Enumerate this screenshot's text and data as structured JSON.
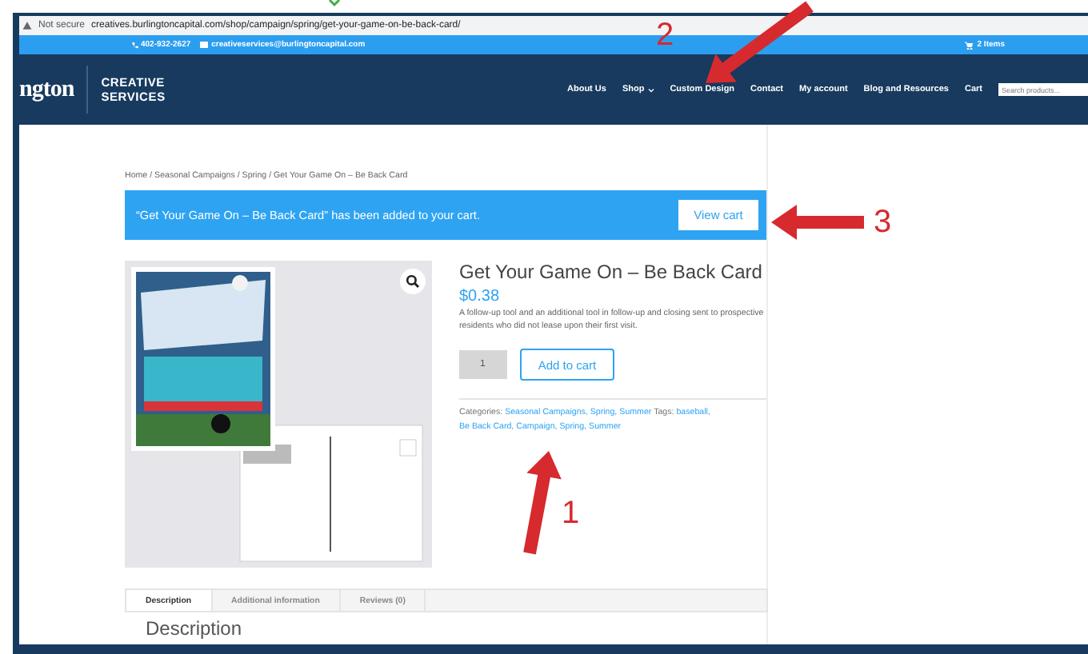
{
  "browser": {
    "security": "Not secure",
    "url": "creatives.burlingtoncapital.com/shop/campaign/spring/get-your-game-on-be-back-card/"
  },
  "top_bar": {
    "phone": "402-932-2627",
    "email": "creativeservices@burlingtoncapital.com",
    "cart": "2 Items"
  },
  "header": {
    "logo_text": "ngton",
    "brand_lines": [
      "CREATIVE",
      "SERVICES"
    ],
    "nav": [
      {
        "label": "About Us",
        "dropdown": false
      },
      {
        "label": "Shop",
        "dropdown": true
      },
      {
        "label": "Custom Design",
        "dropdown": false
      },
      {
        "label": "Contact",
        "dropdown": false
      },
      {
        "label": "My account",
        "dropdown": false
      },
      {
        "label": "Blog and Resources",
        "dropdown": false
      },
      {
        "label": "Cart",
        "dropdown": false
      }
    ],
    "search": {
      "placeholder": "Search products..."
    }
  },
  "breadcrumb": "Home / Seasonal Campaigns / Spring / Get Your Game On – Be Back Card",
  "notice": {
    "message": "“Get Your Game On – Be Back Card” has been added to your cart.",
    "button": "View cart"
  },
  "product": {
    "title": "Get Your Game On – Be Back Card",
    "price": "$0.38",
    "description": "A follow-up tool and an additional tool in follow-up and closing sent to prospective residents who did not lease upon their first visit.",
    "quantity": "1",
    "add_button": "Add to cart",
    "categories": {
      "label": "Categories:",
      "links": [
        "Seasonal Campaigns,",
        "Spring,",
        "Summer"
      ]
    },
    "tags": {
      "label": "Tags:",
      "links": [
        "baseball,",
        "Be Back Card,",
        "Campaign,",
        "Spring,",
        "Summer"
      ]
    }
  },
  "tabs": [
    {
      "label": "Description",
      "selected": true
    },
    {
      "label": "Additional information",
      "selected": false
    },
    {
      "label": "Reviews (0)",
      "selected": false
    }
  ],
  "section_heading": "Description",
  "annotations": [
    {
      "number": "2"
    },
    {
      "number": "3"
    },
    {
      "number": "1"
    }
  ]
}
